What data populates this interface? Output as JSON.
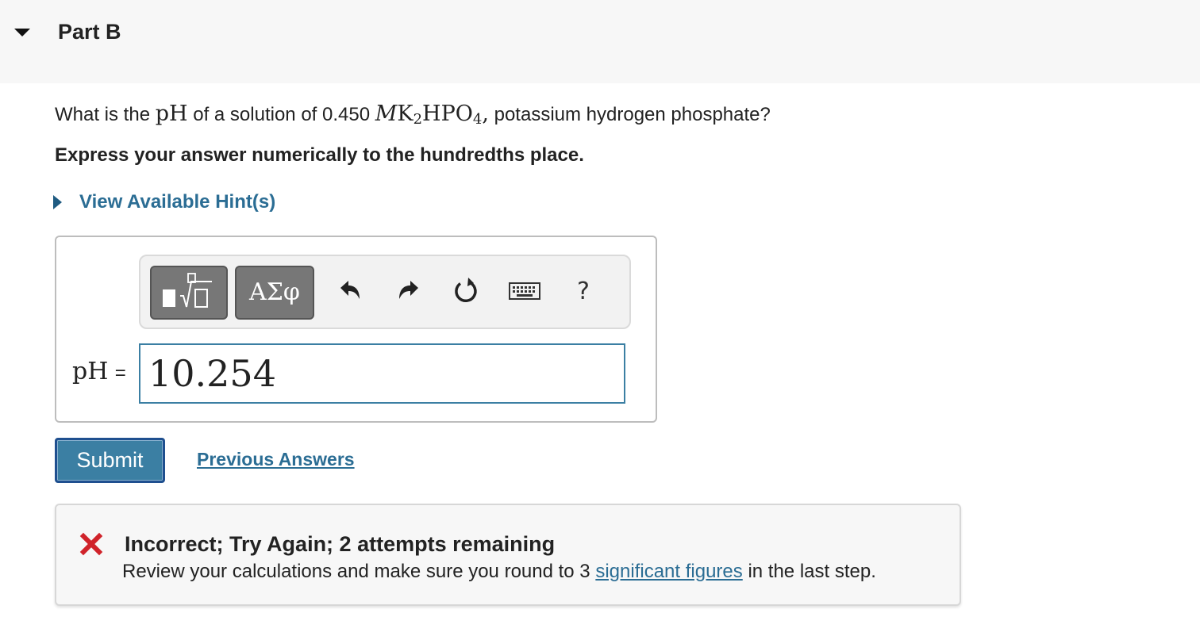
{
  "part": {
    "title": "Part B"
  },
  "question": {
    "prefix": "What is the",
    "ph_symbol": "pH",
    "middle": "of a solution of 0.450",
    "molar_symbol": "M",
    "formula_k": "K",
    "formula_k_sub": "2",
    "formula_hpo": "HPO",
    "formula_hpo_sub": "4",
    "comma": ",",
    "suffix": "potassium hydrogen phosphate?"
  },
  "instruction": "Express your answer numerically to the hundredths place.",
  "hints": {
    "label": "View Available Hint(s)"
  },
  "toolbar": {
    "greek_label": "ΑΣφ",
    "help_label": "?",
    "icons": [
      "templates-icon",
      "undo-icon",
      "redo-icon",
      "reset-icon",
      "keyboard-icon"
    ]
  },
  "answer": {
    "label": "pH",
    "equals": "=",
    "value": "10.254"
  },
  "actions": {
    "submit_label": "Submit",
    "previous_answers_label": "Previous Answers"
  },
  "feedback": {
    "status_icon": "x-mark-icon",
    "title": "Incorrect; Try Again; 2 attempts remaining",
    "body_prefix": "Review your calculations and make sure you round to 3",
    "body_link": "significant figures",
    "body_suffix": "in the last step."
  },
  "colors": {
    "link": "#2b6d94",
    "accent": "#3b7fa3",
    "error": "#d0232a",
    "header_bg": "#f7f7f7"
  }
}
